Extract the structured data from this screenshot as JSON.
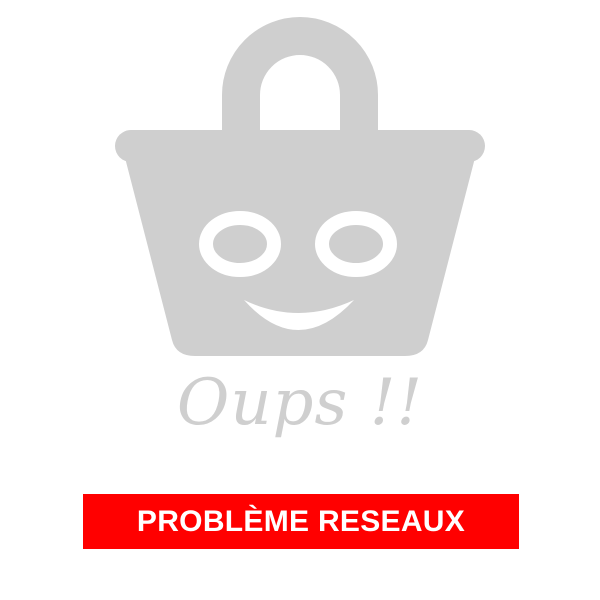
{
  "error": {
    "illustration_icon": "smiling-shopping-basket-icon",
    "headline": "Oups !!",
    "message": "PROBLÈME RESEAUX"
  },
  "colors": {
    "background": "#ffffff",
    "illustration": "#cfcfcf",
    "banner": "#ff0000",
    "banner_text": "#ffffff"
  }
}
